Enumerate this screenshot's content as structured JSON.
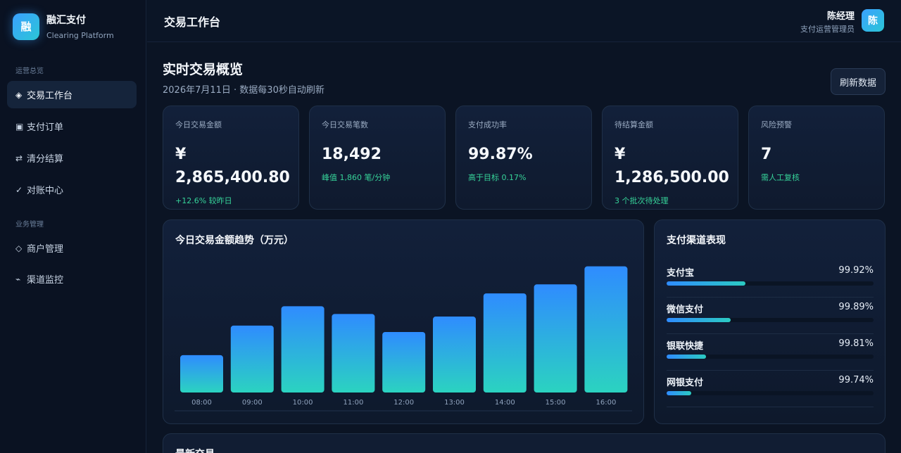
{
  "brand": {
    "logo": "融",
    "name": "融汇支付",
    "subtitle": "Clearing Platform"
  },
  "sidebar": {
    "group1": "运营总览",
    "group2": "业务管理",
    "items": [
      {
        "icon": "◈",
        "label": "交易工作台",
        "active": true
      },
      {
        "icon": "▣",
        "label": "支付订单"
      },
      {
        "icon": "⇄",
        "label": "清分结算"
      },
      {
        "icon": "✓",
        "label": "对账中心"
      },
      {
        "icon": "◇",
        "label": "商户管理"
      },
      {
        "icon": "⌁",
        "label": "渠道监控"
      }
    ]
  },
  "header": {
    "title": "交易工作台",
    "user_name": "陈经理",
    "user_role": "支付运营管理员",
    "avatar": "陈"
  },
  "overview": {
    "title": "实时交易概览",
    "subtitle": "2026年7月11日 · 数据每30秒自动刷新",
    "refresh_label": "刷新数据"
  },
  "cards": [
    {
      "label": "今日交易金额",
      "value": "¥ 2,865,400.80",
      "note": "+12.6% 较昨日"
    },
    {
      "label": "今日交易笔数",
      "value": "18,492",
      "note": "峰值 1,860 笔/分钟"
    },
    {
      "label": "支付成功率",
      "value": "99.87%",
      "note": "高于目标 0.17%"
    },
    {
      "label": "待结算金额",
      "value": "¥ 1,286,500.00",
      "note": "3 个批次待处理"
    },
    {
      "label": "风险预警",
      "value": "7",
      "note": "需人工复核"
    }
  ],
  "chart_data": {
    "type": "bar",
    "title": "今日交易金额趋势（万元）",
    "categories": [
      "08:00",
      "09:00",
      "10:00",
      "11:00",
      "12:00",
      "13:00",
      "14:00",
      "15:00",
      "16:00"
    ],
    "values": [
      29,
      52,
      67,
      61,
      47,
      59,
      77,
      84,
      98
    ],
    "ylim": [
      0,
      100
    ],
    "grid": false,
    "colors": {
      "bar_top": "#2f8cff",
      "bar_bottom": "#2bd3c0"
    }
  },
  "channels": {
    "title": "支付渠道表现",
    "items": [
      {
        "name": "支付宝",
        "rate": "99.92%",
        "share": 0.38
      },
      {
        "name": "微信支付",
        "rate": "99.89%",
        "share": 0.31
      },
      {
        "name": "银联快捷",
        "rate": "99.81%",
        "share": 0.19
      },
      {
        "name": "网银支付",
        "rate": "99.74%",
        "share": 0.12
      }
    ]
  },
  "latest": {
    "title": "最新交易"
  }
}
